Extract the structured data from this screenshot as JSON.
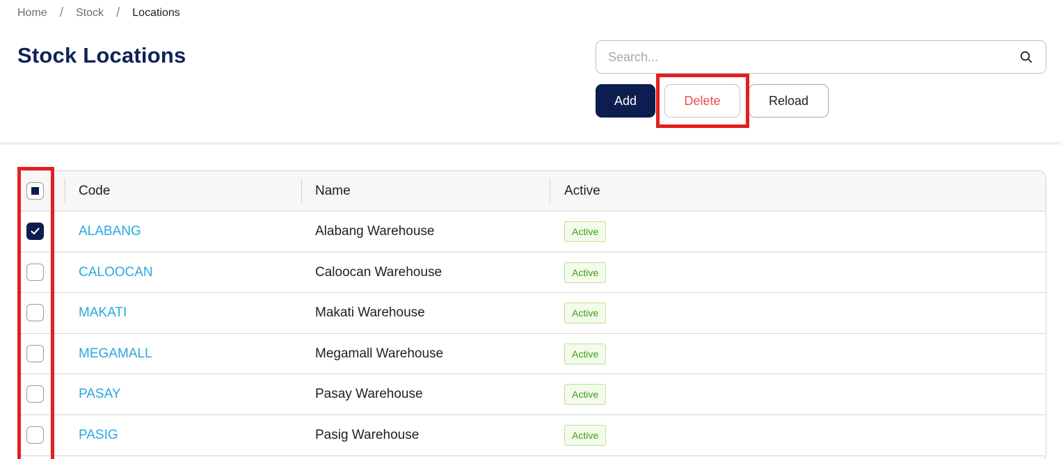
{
  "breadcrumb": {
    "items": [
      "Home",
      "Stock",
      "Locations"
    ],
    "separator": "/"
  },
  "page": {
    "title": "Stock Locations"
  },
  "search": {
    "placeholder": "Search...",
    "value": "",
    "icon": "search-icon"
  },
  "toolbar": {
    "add_label": "Add",
    "delete_label": "Delete",
    "reload_label": "Reload"
  },
  "table": {
    "columns": [
      "Code",
      "Name",
      "Active"
    ],
    "header_checkbox_state": "indeterminate",
    "rows": [
      {
        "code": "ALABANG",
        "name": "Alabang Warehouse",
        "status": "Active",
        "checked": true
      },
      {
        "code": "CALOOCAN",
        "name": "Caloocan Warehouse",
        "status": "Active",
        "checked": false
      },
      {
        "code": "MAKATI",
        "name": "Makati Warehouse",
        "status": "Active",
        "checked": false
      },
      {
        "code": "MEGAMALL",
        "name": "Megamall Warehouse",
        "status": "Active",
        "checked": false
      },
      {
        "code": "PASAY",
        "name": "Pasay Warehouse",
        "status": "Active",
        "checked": false
      },
      {
        "code": "PASIG",
        "name": "Pasig Warehouse",
        "status": "Active",
        "checked": false
      }
    ]
  },
  "colors": {
    "brand": "#0d1d4f",
    "title": "#0d2257",
    "link": "#2aa7e0",
    "danger": "#ef4b4b",
    "success": "#3f9a1a",
    "highlight": "#e41f1f"
  }
}
